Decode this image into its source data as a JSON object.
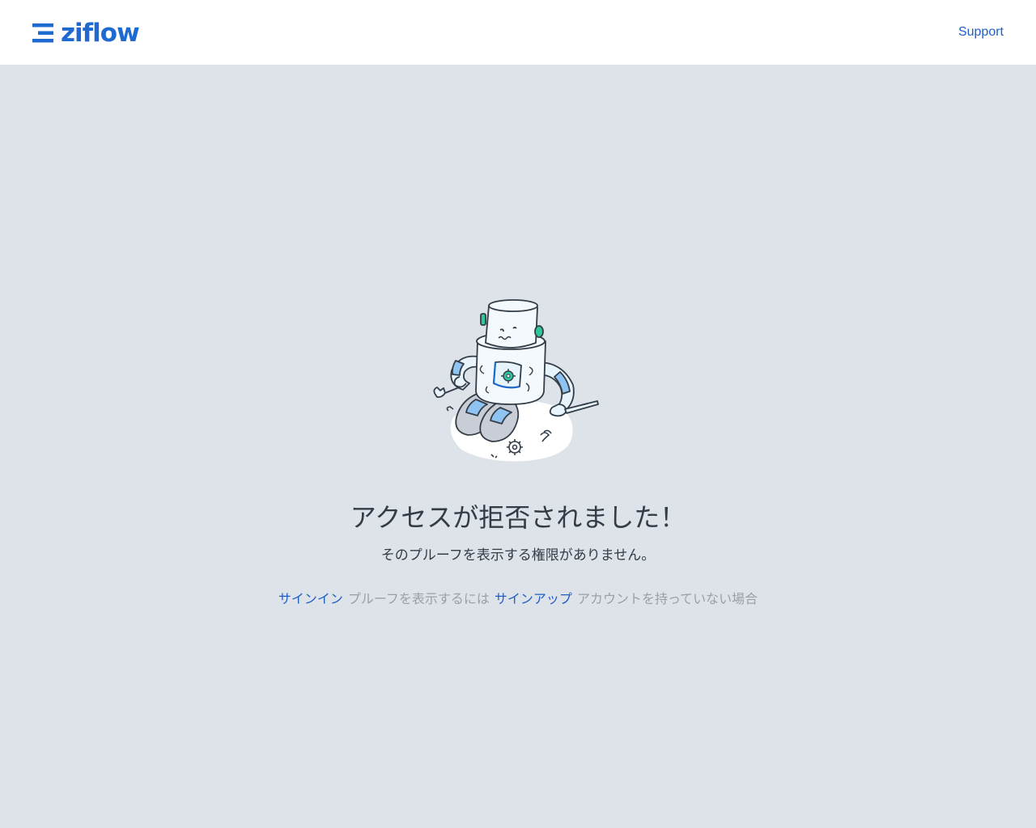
{
  "colors": {
    "brand_blue": "#1e6ad1",
    "link_blue": "#1f5fc4",
    "text_dark": "#333d48",
    "text_muted": "#9aa0a8",
    "page_bg": "#dee2e9"
  },
  "header": {
    "logo_icon": "ziflow-logo-icon",
    "logo_text": "ziflow",
    "support_label": "Support"
  },
  "illustration": {
    "icon": "robot-repair-illustration"
  },
  "main": {
    "title": "アクセスが拒否されました！",
    "subtitle": "そのプルーフを表示する権限がありません。",
    "signin_label": "サインイン",
    "signin_suffix": "プルーフを表示するには",
    "signup_label": "サインアップ",
    "signup_suffix": "アカウントを持っていない場合"
  }
}
